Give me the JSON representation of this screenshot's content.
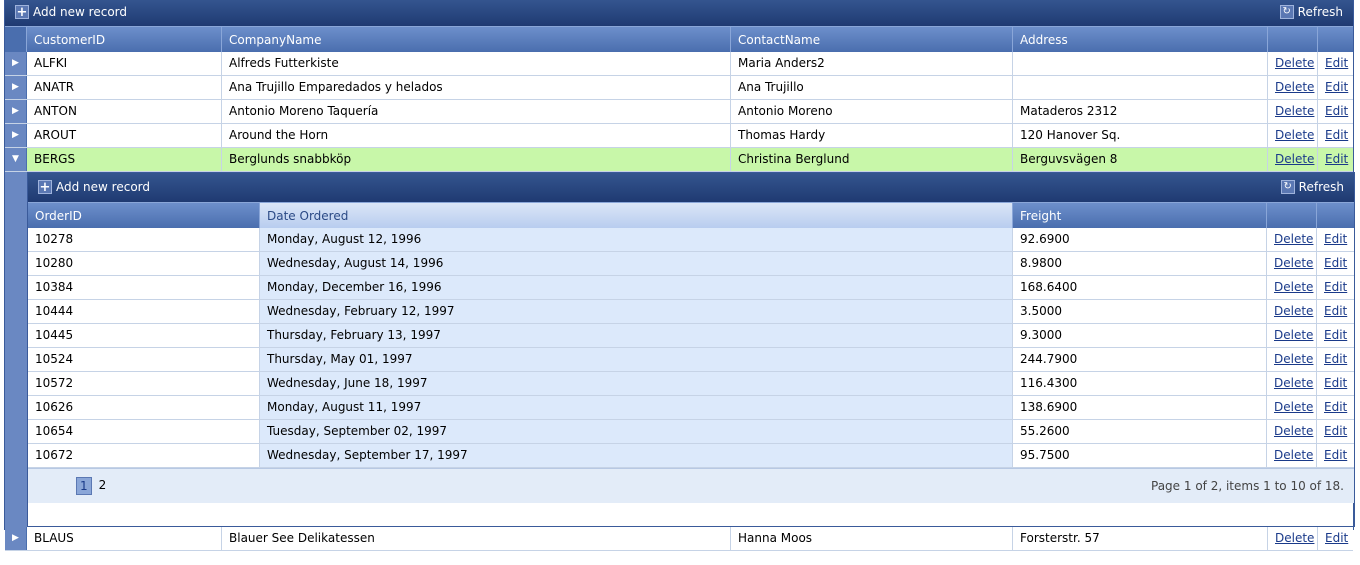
{
  "master": {
    "toolbar": {
      "add_label": "Add new record",
      "refresh_label": "Refresh"
    },
    "columns": [
      "CustomerID",
      "CompanyName",
      "ContactName",
      "Address",
      "",
      ""
    ],
    "rows": [
      {
        "id": "ALFKI",
        "company": "Alfreds Futterkiste",
        "contact": "Maria Anders2",
        "address": "",
        "delete": "Delete",
        "edit": "Edit"
      },
      {
        "id": "ANATR",
        "company": "Ana Trujillo Emparedados y helados",
        "contact": "Ana Trujillo",
        "address": "",
        "delete": "Delete",
        "edit": "Edit"
      },
      {
        "id": "ANTON",
        "company": "Antonio Moreno Taquería",
        "contact": "Antonio Moreno",
        "address": "Mataderos 2312",
        "delete": "Delete",
        "edit": "Edit"
      },
      {
        "id": "AROUT",
        "company": "Around the Horn",
        "contact": "Thomas Hardy",
        "address": "120 Hanover Sq.",
        "delete": "Delete",
        "edit": "Edit"
      },
      {
        "id": "BERGS",
        "company": "Berglunds snabbköp",
        "contact": "Christina Berglund",
        "address": "Berguvsvägen 8",
        "delete": "Delete",
        "edit": "Edit"
      },
      {
        "id": "BLAUS",
        "company": "Blauer See Delikatessen",
        "contact": "Hanna Moos",
        "address": "Forsterstr. 57",
        "delete": "Delete",
        "edit": "Edit"
      }
    ]
  },
  "detail": {
    "toolbar": {
      "add_label": "Add new record",
      "refresh_label": "Refresh"
    },
    "columns": [
      "OrderID",
      "Date Ordered",
      "Freight",
      "",
      ""
    ],
    "rows": [
      {
        "order": "10278",
        "date": "Monday, August 12, 1996",
        "freight": "92.6900",
        "delete": "Delete",
        "edit": "Edit"
      },
      {
        "order": "10280",
        "date": "Wednesday, August 14, 1996",
        "freight": "8.9800",
        "delete": "Delete",
        "edit": "Edit"
      },
      {
        "order": "10384",
        "date": "Monday, December 16, 1996",
        "freight": "168.6400",
        "delete": "Delete",
        "edit": "Edit"
      },
      {
        "order": "10444",
        "date": "Wednesday, February 12, 1997",
        "freight": "3.5000",
        "delete": "Delete",
        "edit": "Edit"
      },
      {
        "order": "10445",
        "date": "Thursday, February 13, 1997",
        "freight": "9.3000",
        "delete": "Delete",
        "edit": "Edit"
      },
      {
        "order": "10524",
        "date": "Thursday, May 01, 1997",
        "freight": "244.7900",
        "delete": "Delete",
        "edit": "Edit"
      },
      {
        "order": "10572",
        "date": "Wednesday, June 18, 1997",
        "freight": "116.4300",
        "delete": "Delete",
        "edit": "Edit"
      },
      {
        "order": "10626",
        "date": "Monday, August 11, 1997",
        "freight": "138.6900",
        "delete": "Delete",
        "edit": "Edit"
      },
      {
        "order": "10654",
        "date": "Tuesday, September 02, 1997",
        "freight": "55.2600",
        "delete": "Delete",
        "edit": "Edit"
      },
      {
        "order": "10672",
        "date": "Wednesday, September 17, 1997",
        "freight": "95.7500",
        "delete": "Delete",
        "edit": "Edit"
      }
    ],
    "pager": {
      "pages": [
        "1",
        "2"
      ],
      "current": "1",
      "info": "Page 1 of 2, items 1 to 10 of 18."
    }
  },
  "colors": {
    "header": "#4a6eae",
    "toolbar": "#1f3a72",
    "selected_row": "#c8f7a9",
    "sorted_column": "#dce9fb"
  }
}
